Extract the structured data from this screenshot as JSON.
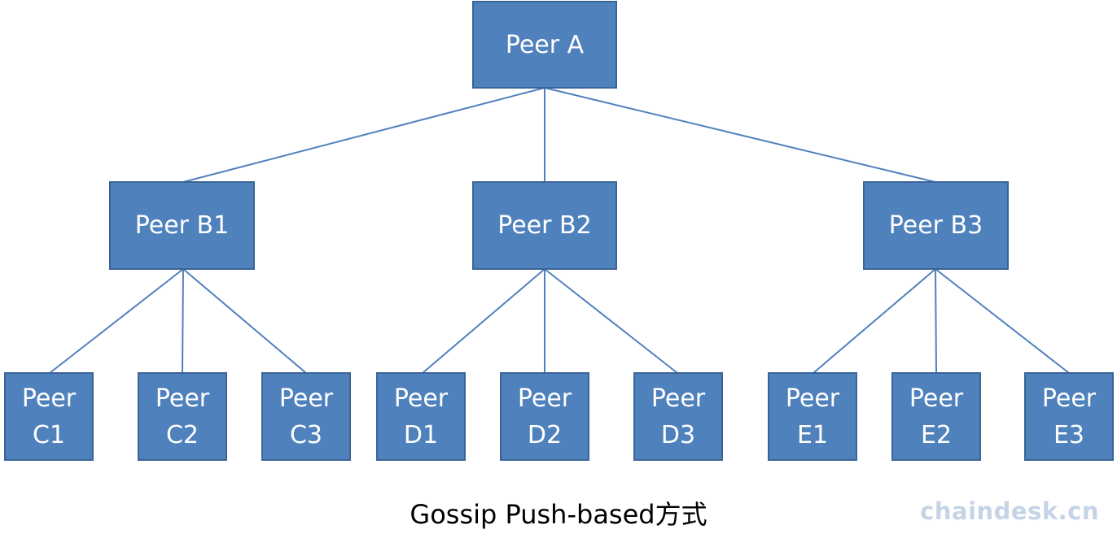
{
  "diagram": {
    "root": {
      "id": "A",
      "label": "Peer A"
    },
    "level2": [
      {
        "id": "B1",
        "label": "Peer B1"
      },
      {
        "id": "B2",
        "label": "Peer B2"
      },
      {
        "id": "B3",
        "label": "Peer B3"
      }
    ],
    "level3": [
      {
        "id": "C1",
        "line1": "Peer",
        "line2": "C1",
        "parent": "B1"
      },
      {
        "id": "C2",
        "line1": "Peer",
        "line2": "C2",
        "parent": "B1"
      },
      {
        "id": "C3",
        "line1": "Peer",
        "line2": "C3",
        "parent": "B1"
      },
      {
        "id": "D1",
        "line1": "Peer",
        "line2": "D1",
        "parent": "B2"
      },
      {
        "id": "D2",
        "line1": "Peer",
        "line2": "D2",
        "parent": "B2"
      },
      {
        "id": "D3",
        "line1": "Peer",
        "line2": "D3",
        "parent": "B2"
      },
      {
        "id": "E1",
        "line1": "Peer",
        "line2": "E1",
        "parent": "B3"
      },
      {
        "id": "E2",
        "line1": "Peer",
        "line2": "E2",
        "parent": "B3"
      },
      {
        "id": "E3",
        "line1": "Peer",
        "line2": "E3",
        "parent": "B3"
      }
    ],
    "caption": "Gossip Push-based方式",
    "watermark": "chaindesk.cn",
    "colors": {
      "box_fill": "#4f81bd",
      "box_border": "#3a6497",
      "edge": "#4f81bd",
      "text": "#ffffff"
    }
  }
}
